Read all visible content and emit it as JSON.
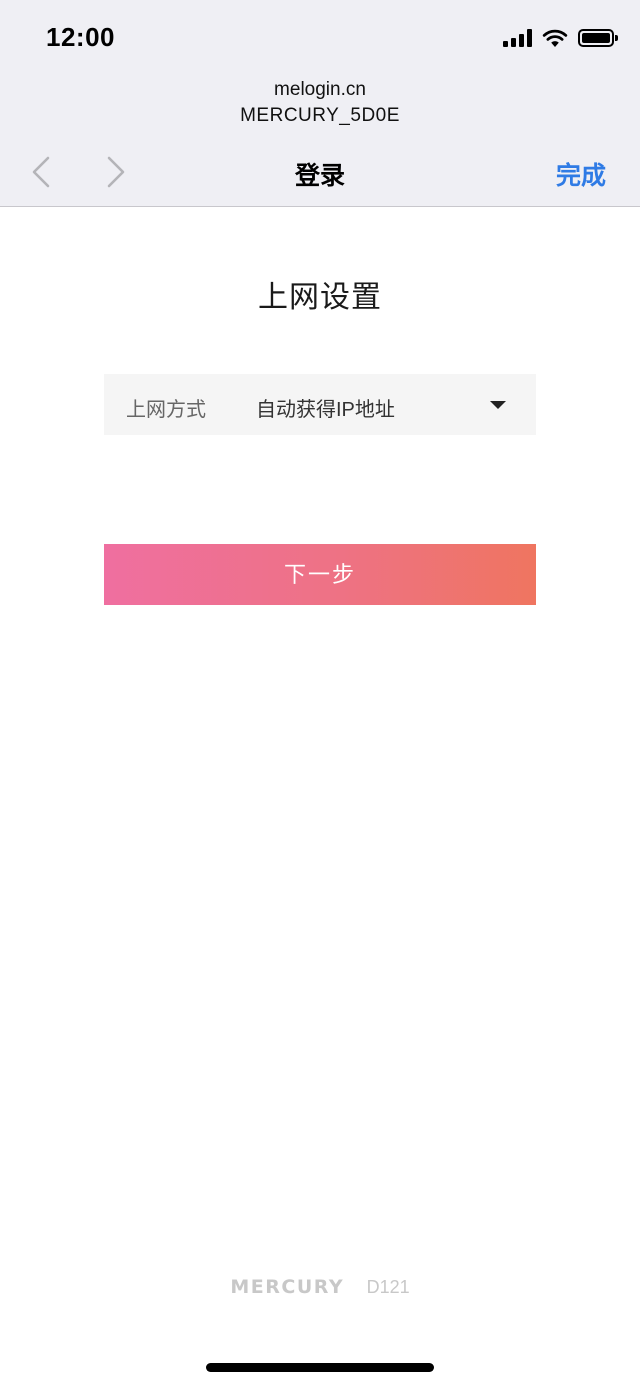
{
  "status_bar": {
    "time": "12:00",
    "icons": [
      "signal-icon",
      "wifi-icon",
      "battery-icon"
    ]
  },
  "browser": {
    "url_host": "melogin.cn",
    "ssid": "MERCURY_5D0E",
    "nav_title": "登录",
    "done_label": "完成",
    "back_icon": "chevron-left-icon",
    "forward_icon": "chevron-right-icon"
  },
  "page": {
    "title": "上网设置",
    "connection_type": {
      "label": "上网方式",
      "value": "自动获得IP地址"
    },
    "next_button_label": "下一步"
  },
  "footer": {
    "brand": "MERCURY",
    "model": "D121"
  },
  "colors": {
    "accent_blue": "#2f7be5",
    "button_gradient_start": "#ef6fa0",
    "button_gradient_end": "#ef7560",
    "bar_background": "#efeff4",
    "field_background": "#f5f5f5"
  }
}
